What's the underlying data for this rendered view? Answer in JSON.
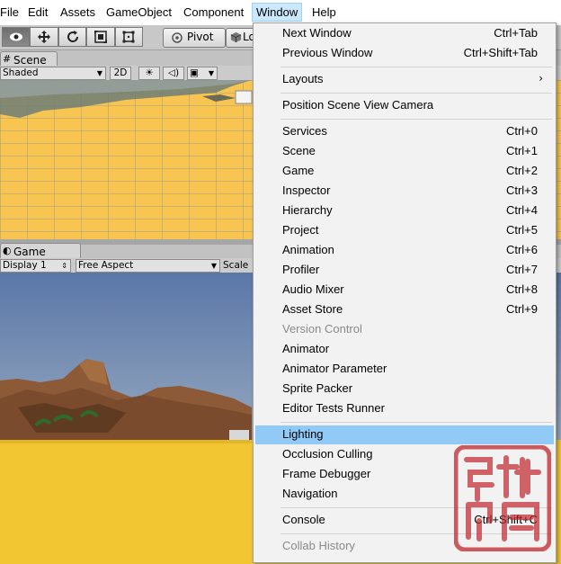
{
  "menubar": {
    "items": [
      "File",
      "Edit",
      "Assets",
      "GameObject",
      "Component",
      "Window",
      "Help"
    ]
  },
  "toolbar": {
    "pivot_label": "Pivot",
    "local_label": "Lo"
  },
  "scene_panel": {
    "tab_label": "Scene",
    "shading_mode": "Shaded",
    "mode_2d_label": "2D"
  },
  "game_panel": {
    "tab_label": "Game",
    "display_label": "Display 1",
    "aspect_label": "Free Aspect",
    "scale_label": "Scale"
  },
  "window_menu": {
    "items": [
      {
        "label": "Next Window",
        "shortcut": "Ctrl+Tab"
      },
      {
        "label": "Previous Window",
        "shortcut": "Ctrl+Shift+Tab"
      },
      {
        "label": "Layouts",
        "shortcut": "",
        "submenu": true
      },
      {
        "label": "Position Scene View Camera",
        "shortcut": ""
      },
      {
        "label": "Services",
        "shortcut": "Ctrl+0"
      },
      {
        "label": "Scene",
        "shortcut": "Ctrl+1"
      },
      {
        "label": "Game",
        "shortcut": "Ctrl+2"
      },
      {
        "label": "Inspector",
        "shortcut": "Ctrl+3"
      },
      {
        "label": "Hierarchy",
        "shortcut": "Ctrl+4"
      },
      {
        "label": "Project",
        "shortcut": "Ctrl+5"
      },
      {
        "label": "Animation",
        "shortcut": "Ctrl+6"
      },
      {
        "label": "Profiler",
        "shortcut": "Ctrl+7"
      },
      {
        "label": "Audio Mixer",
        "shortcut": "Ctrl+8"
      },
      {
        "label": "Asset Store",
        "shortcut": "Ctrl+9"
      },
      {
        "label": "Version Control",
        "shortcut": "",
        "disabled": true
      },
      {
        "label": "Animator",
        "shortcut": ""
      },
      {
        "label": "Animator Parameter",
        "shortcut": ""
      },
      {
        "label": "Sprite Packer",
        "shortcut": ""
      },
      {
        "label": "Editor Tests Runner",
        "shortcut": ""
      },
      {
        "label": "Lighting",
        "shortcut": "",
        "highlighted": true
      },
      {
        "label": "Occlusion Culling",
        "shortcut": ""
      },
      {
        "label": "Frame Debugger",
        "shortcut": ""
      },
      {
        "label": "Navigation",
        "shortcut": ""
      },
      {
        "label": "Console",
        "shortcut": "Ctrl+Shift+C"
      },
      {
        "label": "Collab History",
        "shortcut": "",
        "disabled": true
      }
    ]
  },
  "watermark": {
    "text": "强壮印增"
  },
  "colors": {
    "menu_highlight": "#91c9f7",
    "menubar_active": "#cce8ff",
    "scene_ground": "#f8c550",
    "stamp_red": "#c0262c"
  }
}
